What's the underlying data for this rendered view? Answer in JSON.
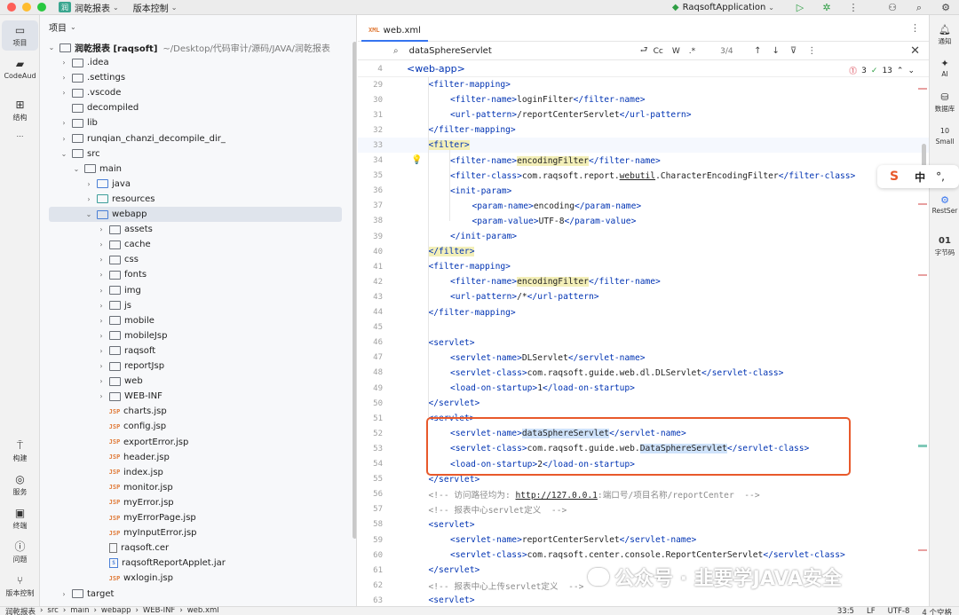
{
  "titlebar": {
    "project_badge": "润",
    "project_name": "润乾报表",
    "vcs_label": "版本控制",
    "run_config": "RaqsoftApplication"
  },
  "left_strip": [
    {
      "label": "项目",
      "icon": "folder-icon"
    },
    {
      "label": "CodeAud",
      "icon": "codeaudit-icon"
    },
    {
      "label": "结构",
      "icon": "structure-icon"
    },
    {
      "label": "…",
      "icon": "more-icon"
    },
    {
      "label": "构建",
      "icon": "build-icon"
    },
    {
      "label": "服务",
      "icon": "services-icon"
    },
    {
      "label": "终端",
      "icon": "terminal-icon"
    },
    {
      "label": "问题",
      "icon": "problems-icon"
    },
    {
      "label": "版本控制",
      "icon": "vcs-icon"
    }
  ],
  "project_panel": {
    "title": "项目",
    "root_name": "润乾报表 [raqsoft]",
    "root_path": "~/Desktop/代码审计/源码/JAVA/润乾报表",
    "tree": [
      {
        "label": ".idea",
        "level": 1,
        "arrow": "›",
        "type": "folder"
      },
      {
        "label": ".settings",
        "level": 1,
        "arrow": "›",
        "type": "folder"
      },
      {
        "label": ".vscode",
        "level": 1,
        "arrow": "›",
        "type": "folder"
      },
      {
        "label": "decompiled",
        "level": 1,
        "arrow": "",
        "type": "folder"
      },
      {
        "label": "lib",
        "level": 1,
        "arrow": "›",
        "type": "folder"
      },
      {
        "label": "runqian_chanzi_decompile_dir_",
        "level": 1,
        "arrow": "›",
        "type": "folder"
      },
      {
        "label": "src",
        "level": 1,
        "arrow": "⌄",
        "type": "folder"
      },
      {
        "label": "main",
        "level": 2,
        "arrow": "⌄",
        "type": "folder"
      },
      {
        "label": "java",
        "level": 3,
        "arrow": "›",
        "type": "folder-blue"
      },
      {
        "label": "resources",
        "level": 3,
        "arrow": "›",
        "type": "folder-teal"
      },
      {
        "label": "webapp",
        "level": 3,
        "arrow": "⌄",
        "type": "folder-blue",
        "selected": true
      },
      {
        "label": "assets",
        "level": 4,
        "arrow": "›",
        "type": "folder"
      },
      {
        "label": "cache",
        "level": 4,
        "arrow": "›",
        "type": "folder"
      },
      {
        "label": "css",
        "level": 4,
        "arrow": "›",
        "type": "folder"
      },
      {
        "label": "fonts",
        "level": 4,
        "arrow": "›",
        "type": "folder"
      },
      {
        "label": "img",
        "level": 4,
        "arrow": "›",
        "type": "folder"
      },
      {
        "label": "js",
        "level": 4,
        "arrow": "›",
        "type": "folder"
      },
      {
        "label": "mobile",
        "level": 4,
        "arrow": "›",
        "type": "folder"
      },
      {
        "label": "mobileJsp",
        "level": 4,
        "arrow": "›",
        "type": "folder"
      },
      {
        "label": "raqsoft",
        "level": 4,
        "arrow": "›",
        "type": "folder"
      },
      {
        "label": "reportJsp",
        "level": 4,
        "arrow": "›",
        "type": "folder"
      },
      {
        "label": "web",
        "level": 4,
        "arrow": "›",
        "type": "folder"
      },
      {
        "label": "WEB-INF",
        "level": 4,
        "arrow": "›",
        "type": "folder"
      },
      {
        "label": "charts.jsp",
        "level": 4,
        "arrow": "",
        "type": "jsp"
      },
      {
        "label": "config.jsp",
        "level": 4,
        "arrow": "",
        "type": "jsp"
      },
      {
        "label": "exportError.jsp",
        "level": 4,
        "arrow": "",
        "type": "jsp"
      },
      {
        "label": "header.jsp",
        "level": 4,
        "arrow": "",
        "type": "jsp"
      },
      {
        "label": "index.jsp",
        "level": 4,
        "arrow": "",
        "type": "jsp"
      },
      {
        "label": "monitor.jsp",
        "level": 4,
        "arrow": "",
        "type": "jsp"
      },
      {
        "label": "myError.jsp",
        "level": 4,
        "arrow": "",
        "type": "jsp"
      },
      {
        "label": "myErrorPage.jsp",
        "level": 4,
        "arrow": "",
        "type": "jsp"
      },
      {
        "label": "myInputError.jsp",
        "level": 4,
        "arrow": "",
        "type": "jsp"
      },
      {
        "label": "raqsoft.cer",
        "level": 4,
        "arrow": "",
        "type": "cer"
      },
      {
        "label": "raqsoftReportApplet.jar",
        "level": 4,
        "arrow": "",
        "type": "jar"
      },
      {
        "label": "wxlogin.jsp",
        "level": 4,
        "arrow": "",
        "type": "jsp"
      },
      {
        "label": "target",
        "level": 1,
        "arrow": "›",
        "type": "folder"
      }
    ]
  },
  "editor": {
    "tab_label": "web.xml",
    "tab_icon_text": "XML",
    "find_text": "dataSphereServlet",
    "find_opts": [
      "Cc",
      "W",
      ".*"
    ],
    "find_count": "3/4",
    "inspect_errors": "3",
    "inspect_ok": "13",
    "sticky_num": "4",
    "sticky_text": "<web-app>",
    "lines": [
      {
        "n": "29",
        "indent": 1,
        "html": "<span class='tag'>&lt;filter-mapping&gt;</span>"
      },
      {
        "n": "30",
        "indent": 2,
        "html": "<span class='tag'>&lt;filter-name&gt;</span>loginFilter<span class='tag'>&lt;/filter-name&gt;</span>"
      },
      {
        "n": "31",
        "indent": 2,
        "html": "<span class='tag'>&lt;url-pattern&gt;</span>/reportCenterServlet<span class='tag'>&lt;/url-pattern&gt;</span>"
      },
      {
        "n": "32",
        "indent": 1,
        "html": "<span class='tag'>&lt;/filter-mapping&gt;</span>"
      },
      {
        "n": "33",
        "indent": 1,
        "html": "<span class='tag hl-yel'>&lt;filter&gt;</span>",
        "current": true
      },
      {
        "n": "34",
        "indent": 2,
        "html": "<span class='tag'>&lt;filter-name&gt;</span><span class='hl-yel'>encodingFilter</span><span class='tag'>&lt;/filter-name&gt;</span>"
      },
      {
        "n": "35",
        "indent": 2,
        "html": "<span class='tag'>&lt;filter-class&gt;</span>com.raqsoft.report.<u>webutil</u>.CharacterEncodingFilter<span class='tag'>&lt;/filter-class&gt;</span>"
      },
      {
        "n": "36",
        "indent": 2,
        "html": "<span class='tag'>&lt;init-param&gt;</span>"
      },
      {
        "n": "37",
        "indent": 3,
        "html": "<span class='tag'>&lt;param-name&gt;</span>encoding<span class='tag'>&lt;/param-name&gt;</span>"
      },
      {
        "n": "38",
        "indent": 3,
        "html": "<span class='tag'>&lt;param-value&gt;</span>UTF-8<span class='tag'>&lt;/param-value&gt;</span>"
      },
      {
        "n": "39",
        "indent": 2,
        "html": "<span class='tag'>&lt;/init-param&gt;</span>"
      },
      {
        "n": "40",
        "indent": 1,
        "html": "<span class='tag hl-yel'>&lt;/filter&gt;</span>"
      },
      {
        "n": "41",
        "indent": 1,
        "html": "<span class='tag'>&lt;filter-mapping&gt;</span>"
      },
      {
        "n": "42",
        "indent": 2,
        "html": "<span class='tag'>&lt;filter-name&gt;</span><span class='hl-yel'>encodingFilter</span><span class='tag'>&lt;/filter-name&gt;</span>"
      },
      {
        "n": "43",
        "indent": 2,
        "html": "<span class='tag'>&lt;url-pattern&gt;</span>/*<span class='tag'>&lt;/url-pattern&gt;</span>"
      },
      {
        "n": "44",
        "indent": 1,
        "html": "<span class='tag'>&lt;/filter-mapping&gt;</span>"
      },
      {
        "n": "45",
        "indent": 0,
        "html": ""
      },
      {
        "n": "46",
        "indent": 1,
        "html": "<span class='tag'>&lt;servlet&gt;</span>"
      },
      {
        "n": "47",
        "indent": 2,
        "html": "<span class='tag'>&lt;servlet-name&gt;</span>DLServlet<span class='tag'>&lt;/servlet-name&gt;</span>"
      },
      {
        "n": "48",
        "indent": 2,
        "html": "<span class='tag'>&lt;servlet-class&gt;</span>com.raqsoft.guide.web.dl.DLServlet<span class='tag'>&lt;/servlet-class&gt;</span>"
      },
      {
        "n": "49",
        "indent": 2,
        "html": "<span class='tag'>&lt;load-on-startup&gt;</span>1<span class='tag'>&lt;/load-on-startup&gt;</span>"
      },
      {
        "n": "50",
        "indent": 1,
        "html": "<span class='tag'>&lt;/servlet&gt;</span>"
      },
      {
        "n": "51",
        "indent": 1,
        "html": "<span class='tag'>&lt;servlet&gt;</span>"
      },
      {
        "n": "52",
        "indent": 2,
        "html": "<span class='tag'>&lt;servlet-name&gt;</span><span class='hl-find'>dataSphereServlet</span><span class='tag'>&lt;/servlet-name&gt;</span>"
      },
      {
        "n": "53",
        "indent": 2,
        "html": "<span class='tag'>&lt;servlet-class&gt;</span>com.raqsoft.guide.web.<span class='hl-find'>DataSphereServlet</span><span class='tag'>&lt;/servlet-class&gt;</span>"
      },
      {
        "n": "54",
        "indent": 2,
        "html": "<span class='tag'>&lt;load-on-startup&gt;</span>2<span class='tag'>&lt;/load-on-startup&gt;</span>"
      },
      {
        "n": "55",
        "indent": 1,
        "html": "<span class='tag'>&lt;/servlet&gt;</span>"
      },
      {
        "n": "56",
        "indent": 1,
        "html": "<span class='cm'>&lt;!-- 访问路径均为: <span class='url'>http://127.0.0.1</span>:端口号/项目名称/reportCenter  --&gt;</span>"
      },
      {
        "n": "57",
        "indent": 1,
        "html": "<span class='cm'>&lt;!-- 报表中心servlet定义  --&gt;</span>"
      },
      {
        "n": "58",
        "indent": 1,
        "html": "<span class='tag'>&lt;servlet&gt;</span>"
      },
      {
        "n": "59",
        "indent": 2,
        "html": "<span class='tag'>&lt;servlet-name&gt;</span>reportCenterServlet<span class='tag'>&lt;/servlet-name&gt;</span>"
      },
      {
        "n": "60",
        "indent": 2,
        "html": "<span class='tag'>&lt;servlet-class&gt;</span>com.raqsoft.center.console.ReportCenterServlet<span class='tag'>&lt;/servlet-class&gt;</span>"
      },
      {
        "n": "61",
        "indent": 1,
        "html": "<span class='tag'>&lt;/servlet&gt;</span>"
      },
      {
        "n": "62",
        "indent": 1,
        "html": "<span class='cm'>&lt;!-- 报表中心上传servlet定义  --&gt;</span>"
      },
      {
        "n": "63",
        "indent": 1,
        "html": "<span class='tag'>&lt;servlet&gt;</span>"
      }
    ]
  },
  "right_strip": [
    {
      "label": "通知",
      "icon": "bell-icon"
    },
    {
      "label": "AI",
      "icon": "ai-icon"
    },
    {
      "label": "数据库",
      "icon": "database-icon"
    },
    {
      "label": "Small",
      "icon": "small-icon"
    },
    {
      "label": "RestSer",
      "icon": "restservice-icon"
    },
    {
      "label": "字节码",
      "icon": "bytecode-icon"
    }
  ],
  "ime": {
    "logo": "S",
    "mode": "中",
    "punct": "°,"
  },
  "statusbar": {
    "crumbs": [
      "润乾报表",
      "src",
      "main",
      "webapp",
      "WEB-INF",
      "web.xml"
    ],
    "position": "33:5",
    "line_sep": "LF",
    "encoding": "UTF-8",
    "indent": "4 个空格"
  },
  "watermark": "公众号 · 韭要学JAVA安全",
  "colors": {
    "accent": "#3574f0",
    "tag": "#0033b3",
    "highlight_box": "#e8592b"
  }
}
